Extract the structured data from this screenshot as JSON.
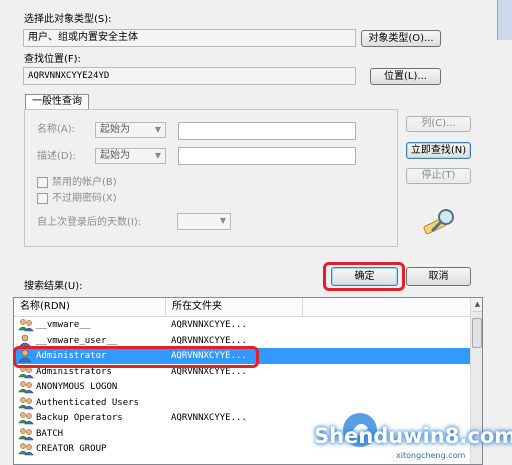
{
  "object_types": {
    "label": "选择此对象类型(S):",
    "value": "用户、组或内置安全主体",
    "button_label": "对象类型(O)..."
  },
  "location": {
    "label": "查找位置(F):",
    "value": "AQRVNNXCYYE24YD",
    "button_label": "位置(L)..."
  },
  "general_queries": {
    "tab_label": "一般性查询",
    "name_label": "名称(A):",
    "name_mode": "起始为",
    "name_value": "",
    "description_label": "描述(D):",
    "description_mode": "起始为",
    "description_value": "",
    "disabled_accounts_label": "禁用的帐户(B)",
    "non_expiring_password_label": "不过期密码(X)",
    "days_since_logon_label": "自上次登录后的天数(I):",
    "days_since_logon_value": ""
  },
  "side_buttons": {
    "columns": "列(C)...",
    "find_now": "立即查找(N)",
    "stop": "停止(T)"
  },
  "dialog_buttons": {
    "ok": "确定",
    "cancel": "取消"
  },
  "results": {
    "label": "搜索结果(U):",
    "columns": [
      "名称(RDN)",
      "所在文件夹"
    ],
    "rows": [
      {
        "name": "__vmware__",
        "folder": "AQRVNNXCYYE...",
        "icon": "group-icon",
        "selected": false
      },
      {
        "name": "__vmware_user__",
        "folder": "AQRVNNXCYYE...",
        "icon": "user-icon",
        "selected": false
      },
      {
        "name": "Administrator",
        "folder": "AQRVNNXCYYE...",
        "icon": "user-icon",
        "selected": true
      },
      {
        "name": "Administrators",
        "folder": "AQRVNNXCYYE...",
        "icon": "group-icon",
        "selected": false
      },
      {
        "name": "ANONYMOUS LOGON",
        "folder": "",
        "icon": "group-icon",
        "selected": false
      },
      {
        "name": "Authenticated Users",
        "folder": "",
        "icon": "group-icon",
        "selected": false
      },
      {
        "name": "Backup Operators",
        "folder": "AQRVNNXCYYE...",
        "icon": "group-icon",
        "selected": false
      },
      {
        "name": "BATCH",
        "folder": "",
        "icon": "group-icon",
        "selected": false
      },
      {
        "name": "CREATOR GROUP",
        "folder": "",
        "icon": "group-icon",
        "selected": false
      }
    ]
  },
  "watermark": {
    "brand": "Shenduwin8.com",
    "sub": "xitongcheng.com"
  },
  "colors": {
    "highlight": "#e0202a",
    "selection": "#3399ff"
  }
}
